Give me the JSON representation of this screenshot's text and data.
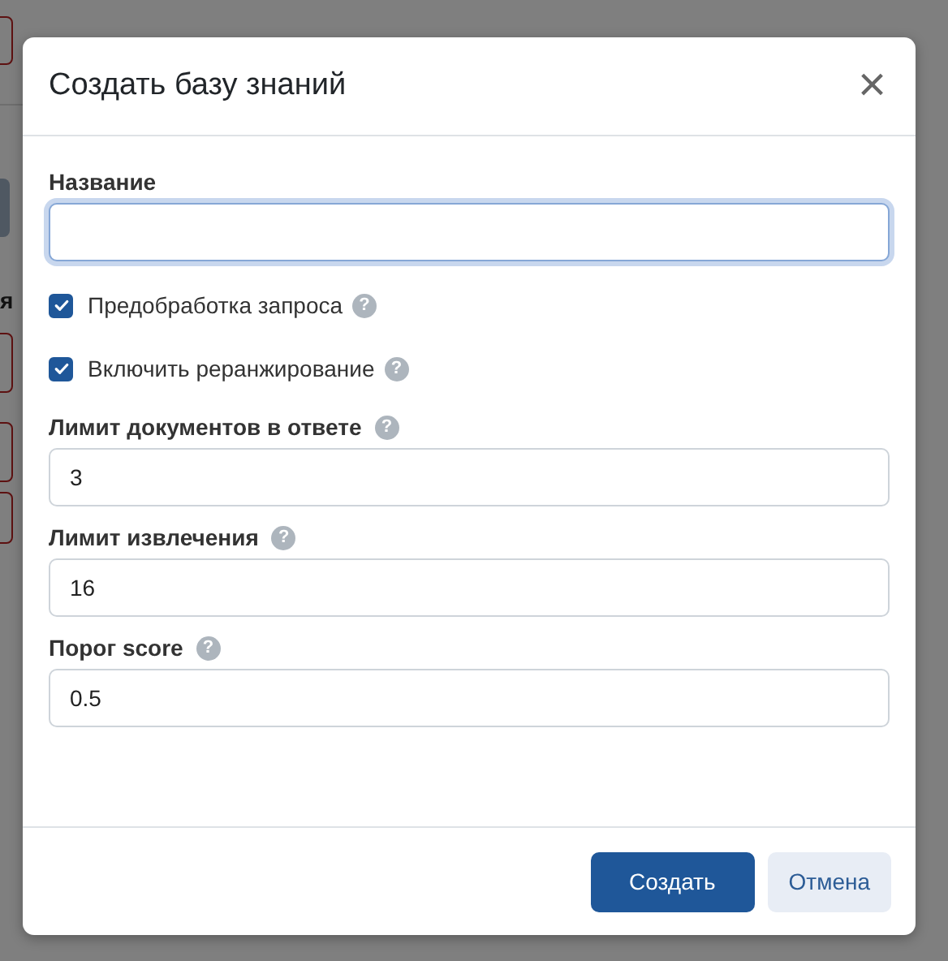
{
  "backdrop": {
    "fragment": "я"
  },
  "dialog": {
    "title": "Создать базу знаний",
    "close_icon": "×"
  },
  "fields": [
    {
      "kind": "text",
      "label": "Название",
      "focused": true
    },
    {
      "kind": "checkbox",
      "label": "Предобработка запроса",
      "checked": true,
      "help": "?"
    },
    {
      "kind": "checkbox",
      "label": "Включить реранжирование",
      "checked": true,
      "help": "?"
    },
    {
      "kind": "text",
      "label": "Лимит документов в ответе",
      "value": "3",
      "focused": false,
      "help": "?"
    },
    {
      "kind": "text",
      "label": "Лимит извлечения",
      "value": "16",
      "focused": false,
      "help": "?"
    },
    {
      "kind": "text",
      "label": "Порог score",
      "value": "0.5",
      "focused": false,
      "help": "?"
    }
  ],
  "buttons": [
    {
      "label": "Создать",
      "primary": true
    },
    {
      "label": "Отмена",
      "primary": false
    }
  ]
}
